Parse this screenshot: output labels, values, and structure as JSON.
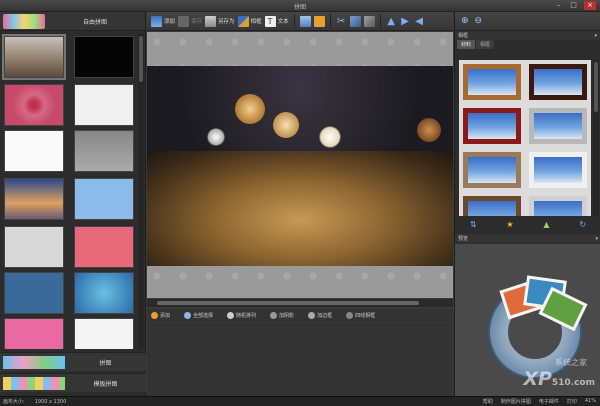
{
  "window": {
    "title": "拼图"
  },
  "left_panel": {
    "header_label": "自由拼图",
    "section_template_label": "拼图",
    "section_template_grid_label": "模板拼图"
  },
  "toolbar": {
    "add": "添加",
    "save": "保存",
    "save_as": "另存为",
    "frame": "相框",
    "text": "文本"
  },
  "action_bar": {
    "add": "添加",
    "select_all": "全部选择",
    "random": "随机排列",
    "shadow": "加阴影",
    "border": "加边框",
    "settings": "四线相框"
  },
  "right_panel": {
    "header": "相框",
    "tabs": [
      "材料",
      "相框"
    ],
    "preview_header": "预览",
    "watermark_big": "XP",
    "watermark_small": "510.com",
    "watermark_sub": "系统之家"
  },
  "status_bar": {
    "size_label": "画布大小:",
    "size_value": "1900 x 1300",
    "help": "帮助",
    "wallpaper": "制作图片拼图",
    "email": "电子邮件",
    "print": "打印",
    "zoom": "41%"
  },
  "colors": {
    "accent_orange": "#e8a030",
    "frame_blue": "#4a7fd0",
    "frame_red": "#8a1a1a"
  }
}
